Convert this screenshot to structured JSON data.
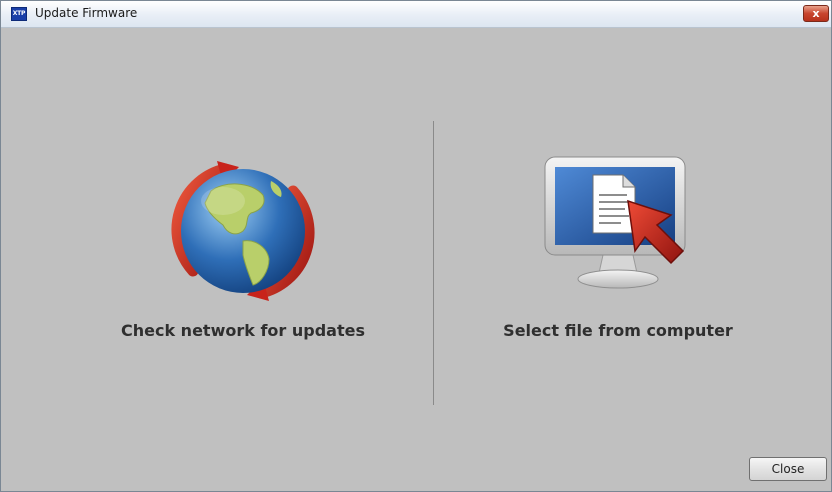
{
  "window": {
    "title": "Update Firmware",
    "app_icon_text": "XTP",
    "close_glyph": "x"
  },
  "options": {
    "network": {
      "label": "Check network for updates",
      "icon": "globe-refresh-icon"
    },
    "file": {
      "label": "Select file from computer",
      "icon": "monitor-document-cursor-icon"
    }
  },
  "footer": {
    "close_label": "Close"
  },
  "colors": {
    "window_bg": "#c0c0c0",
    "arrow_red": "#c8231b",
    "globe_blue": "#2f6fb8",
    "land_green": "#b9cf6a",
    "monitor_screen": "#1f58a8"
  }
}
